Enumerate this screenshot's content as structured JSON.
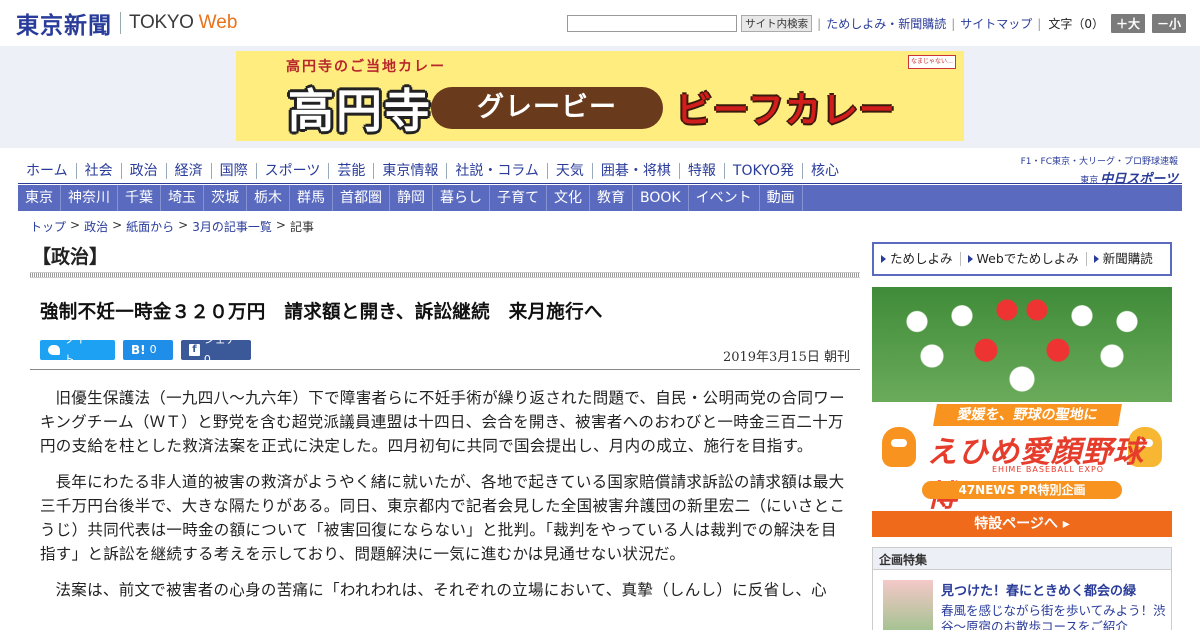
{
  "header": {
    "logo_jp": "東京新聞",
    "logo_en": "TOKYO",
    "logo_web": "Web",
    "search_button": "サイト内検索",
    "links": [
      "ためしよみ・新聞購読",
      "サイトマップ"
    ],
    "fontsize_label": "文字（0）",
    "font_plus": "＋大",
    "font_minus": "－小"
  },
  "banner_ad": {
    "line1": "高円寺のご当地カレー",
    "kanji": "高円寺",
    "pill": "グレービー",
    "curry": "ビーフカレー",
    "badge": "なまじゃない…"
  },
  "nav_main": [
    "ホーム",
    "社会",
    "政治",
    "経済",
    "国際",
    "スポーツ",
    "芸能",
    "東京情報",
    "社説・コラム",
    "天気",
    "囲碁・将棋",
    "特報",
    "TOKYO発",
    "核心"
  ],
  "sports_link": {
    "small": "F1・FC東京・大リーグ・プロ野球速報",
    "mini": "東京",
    "big": "中日スポーツ"
  },
  "nav_region": [
    "東京",
    "神奈川",
    "千葉",
    "埼玉",
    "茨城",
    "栃木",
    "群馬",
    "首都圏",
    "静岡",
    "暮らし",
    "子育て",
    "文化",
    "教育",
    "BOOK",
    "イベント",
    "動画"
  ],
  "breadcrumb": {
    "items": [
      "トップ",
      "政治",
      "紙面から",
      "3月の記事一覧"
    ],
    "current": "記事",
    "sep": ">"
  },
  "article": {
    "section": "【政治】",
    "headline": "強制不妊一時金３２０万円　請求額と開き、訴訟継続　来月施行へ",
    "share": {
      "tweet": "ツイート",
      "hatena": "0",
      "facebook": "シェア 0"
    },
    "date": "2019年3月15日 朝刊",
    "paragraphs": [
      "旧優生保護法（一九四八～九六年）下で障害者らに不妊手術が繰り返された問題で、自民・公明両党の合同ワーキングチーム（ＷＴ）と野党を含む超党派議員連盟は十四日、会合を開き、被害者へのおわびと一時金三百二十万円の支給を柱とした救済法案を正式に決定した。四月初旬に共同で国会提出し、月内の成立、施行を目指す。",
      "長年にわたる非人道的被害の救済がようやく緒に就いたが、各地で起きている国家賠償請求訴訟の請求額は最大三千万円台後半で、大きな隔たりがある。同日、東京都内で記者会見した全国被害弁護団の新里宏二（にいさとこうじ）共同代表は一時金の額について「被害回復にならない」と批判。「裁判をやっている人は裁判での解決を目指す」と訴訟を継続する考えを示しており、問題解決に一気に進むかは見通せない状況だ。",
      "法案は、前文で被害者の心身の苦痛に「われわれは、それぞれの立場において、真摯（しんし）に反省し、心"
    ]
  },
  "sidebar": {
    "links": [
      "ためしよみ",
      "Webでためしよみ",
      "新聞購読"
    ],
    "ehime_ad": {
      "tag": "愛媛を、野球の聖地に",
      "title": "えひめ愛顔野球博",
      "sub": "EHIME BASEBALL EXPO",
      "pr": "47NEWS PR特別企画",
      "bottom": "特設ページへ ▸"
    },
    "feature": {
      "head": "企画特集",
      "title": "見つけた！春にときめく都会の緑",
      "desc": "春風を感じながら街を歩いてみよう！渋谷～原宿のお散歩コースをご紹介"
    }
  }
}
